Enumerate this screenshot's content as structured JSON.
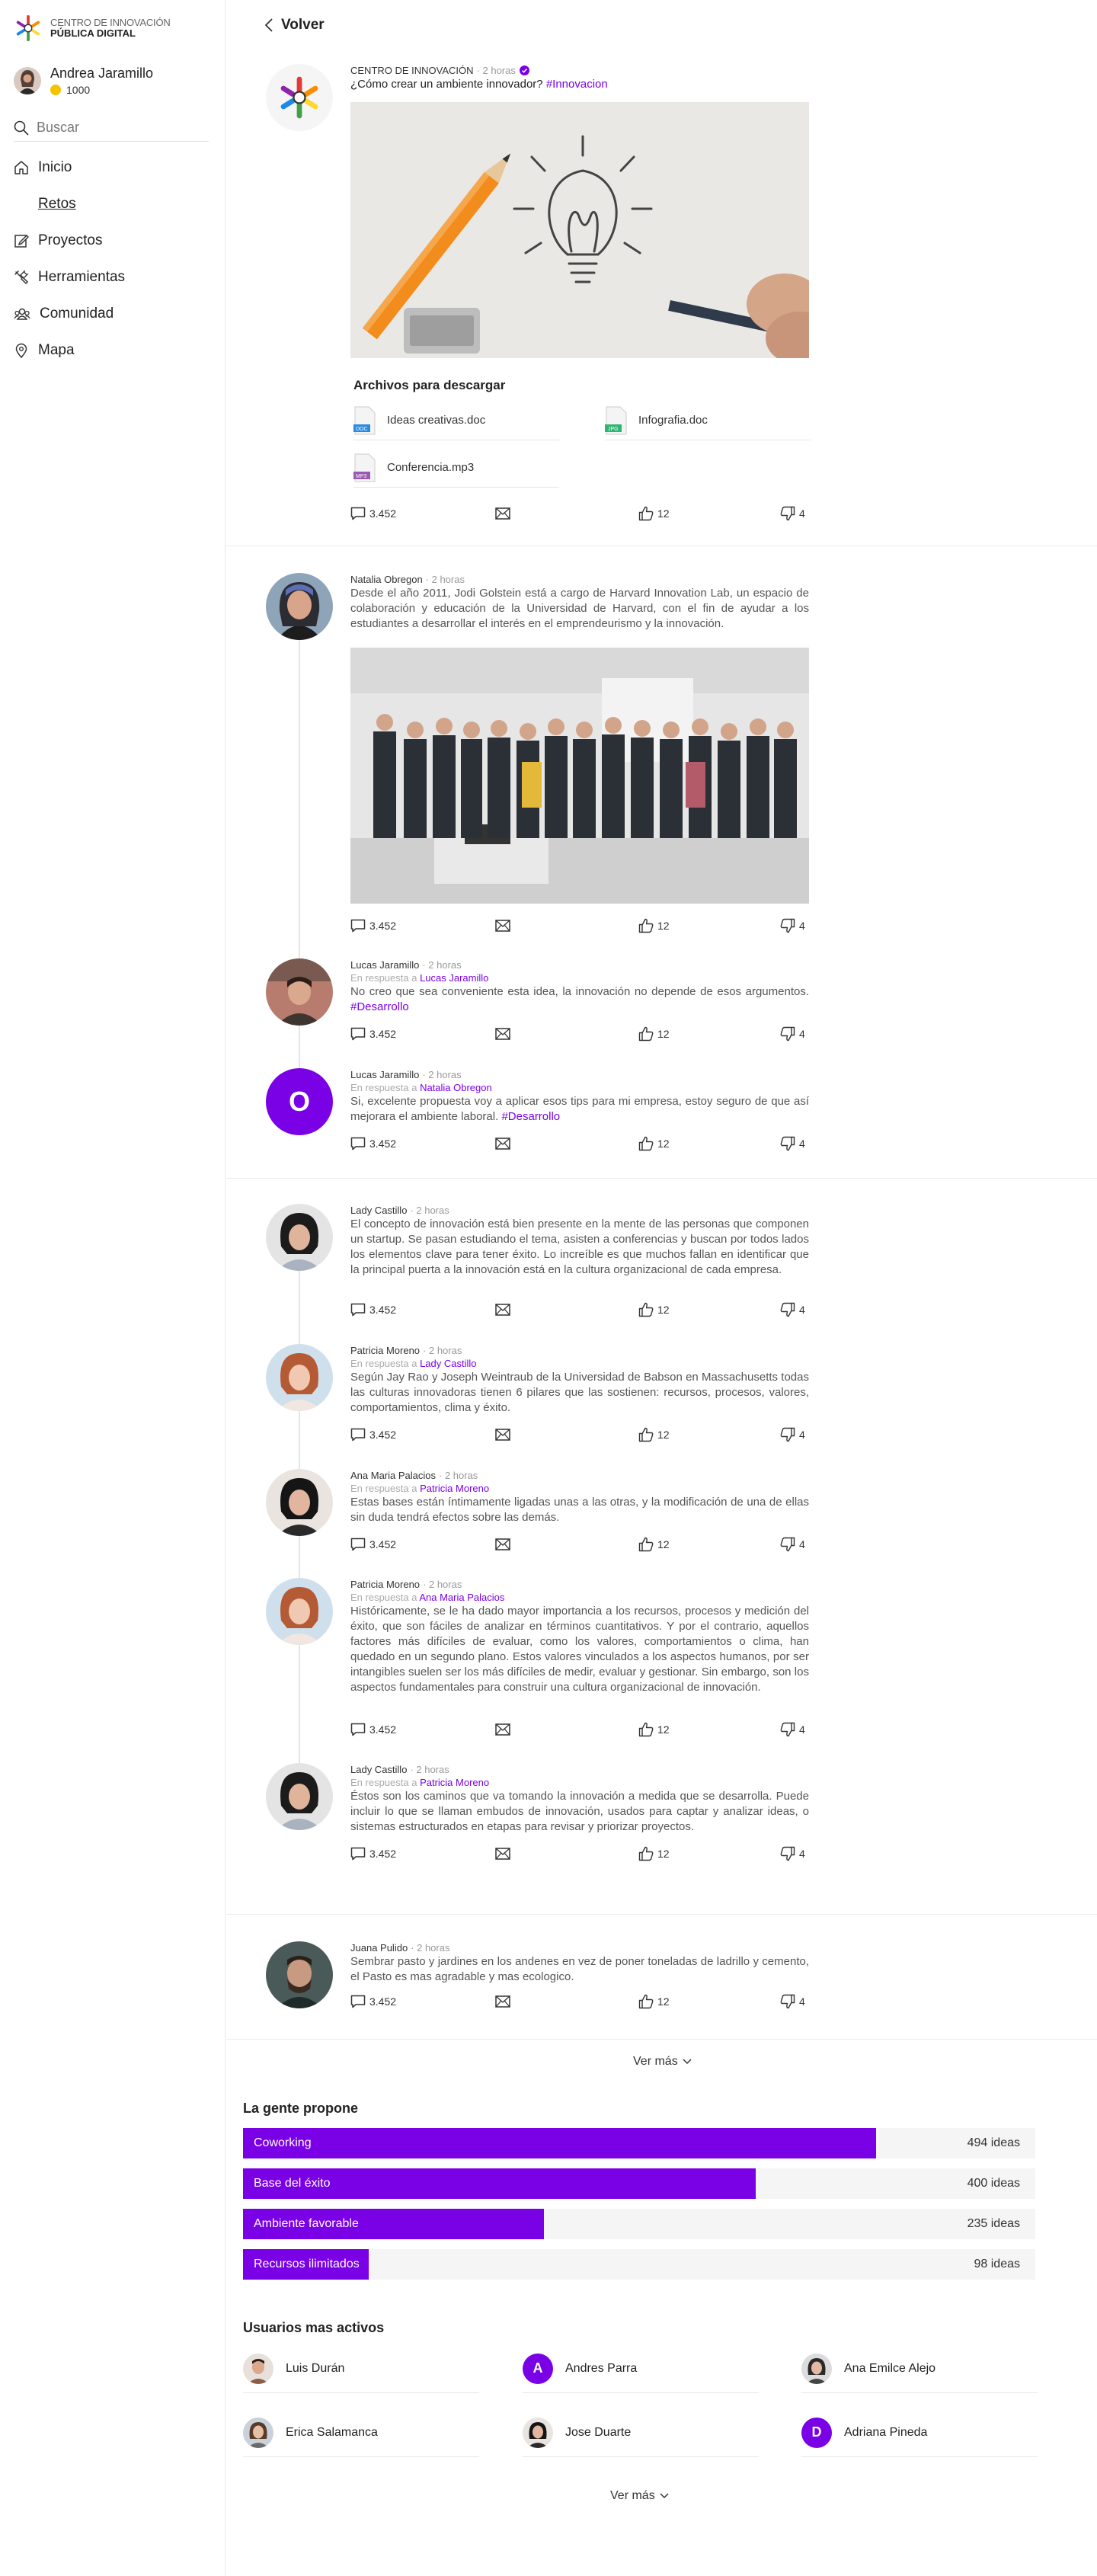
{
  "brand": {
    "line1": "CENTRO DE INNOVACIÓN",
    "line2": "PÚBLICA DIGITAL"
  },
  "user": {
    "name": "Andrea Jaramillo",
    "points": "1000"
  },
  "search": {
    "placeholder": "Buscar"
  },
  "nav": [
    {
      "label": "Inicio",
      "icon": "home-icon"
    },
    {
      "label": "Retos",
      "icon": "flag-icon"
    },
    {
      "label": "Proyectos",
      "icon": "edit-icon"
    },
    {
      "label": "Herramientas",
      "icon": "tools-icon"
    },
    {
      "label": "Comunidad",
      "icon": "community-icon"
    },
    {
      "label": "Mapa",
      "icon": "map-pin-icon"
    }
  ],
  "back_label": "Volver",
  "main_post": {
    "author": "CENTRO DE INNOVACIÓN",
    "time": "· 2 horas",
    "title": "¿Cómo crear un ambiente innovador?",
    "tag": "#Innovacion",
    "files_title": "Archivos para descargar",
    "files": [
      {
        "name": "Ideas creativas.doc",
        "type": "DOC",
        "color": "#2b8ae0"
      },
      {
        "name": "Infografia.doc",
        "type": "JPG",
        "color": "#2bb673"
      },
      {
        "name": "Conferencia.mp3",
        "type": "MP3",
        "color": "#9b59b6"
      }
    ],
    "comments": "3.452",
    "likes": "12",
    "dislikes": "4"
  },
  "threads": [
    {
      "posts": [
        {
          "author": "Natalia Obregon",
          "time": "· 2 horas",
          "reply_prefix": "",
          "reply_to": "",
          "text": "Desde el año 2011, Jodi Golstein está a cargo de Harvard Innovation Lab, un espacio de colaboración y educación de la Universidad de Harvard, con el fin de ayudar a los estudiantes a desarrollar el interés en el emprendeurismo y la innovación.",
          "tag": "",
          "comments": "3.452",
          "likes": "12",
          "dislikes": "4"
        },
        {
          "author": "Lucas Jaramillo",
          "time": "· 2 horas",
          "reply_prefix": "En respuesta a ",
          "reply_to": "Lucas Jaramillo",
          "text": "No creo que sea conveniente esta idea, la innovación no depende de esos argumentos.",
          "tag": "#Desarrollo",
          "comments": "3.452",
          "likes": "12",
          "dislikes": "4"
        },
        {
          "author": "Lucas Jaramillo",
          "time": "· 2 horas",
          "reply_prefix": "En respuesta a ",
          "reply_to": "Natalia Obregon",
          "text": "Si, excelente propuesta voy a aplicar esos tips para mi empresa, estoy seguro de que así mejorara el ambiente laboral.",
          "tag": "#Desarrollo",
          "comments": "3.452",
          "likes": "12",
          "dislikes": "4",
          "avatar_letter": "O"
        }
      ]
    },
    {
      "posts": [
        {
          "author": "Lady Castillo",
          "time": "· 2 horas",
          "reply_prefix": "",
          "reply_to": "",
          "text": "El concepto de innovación está bien presente en la mente de las personas que componen un startup. Se pasan estudiando el tema, asisten a conferencias y buscan por todos lados los elementos clave para tener éxito. Lo increíble es que muchos fallan en identificar que la principal puerta a la innovación está en la cultura organizacional de cada empresa.",
          "tag": "",
          "comments": "3.452",
          "likes": "12",
          "dislikes": "4"
        },
        {
          "author": "Patricia Moreno",
          "time": "· 2 horas",
          "reply_prefix": "En respuesta a ",
          "reply_to": "Lady Castillo",
          "text": "Según Jay Rao y Joseph Weintraub de la Universidad de Babson en Massachusetts todas las culturas innovadoras tienen 6 pilares que las sostienen: recursos, procesos, valores, comportamientos, clima y éxito.",
          "tag": "",
          "comments": "3.452",
          "likes": "12",
          "dislikes": "4"
        },
        {
          "author": "Ana Maria Palacios",
          "time": "· 2 horas",
          "reply_prefix": "En respuesta a ",
          "reply_to": "Patricia Moreno",
          "text": "Estas bases están íntimamente ligadas unas a las otras, y la modificación de una de ellas sin duda tendrá efectos sobre las demás.",
          "tag": "",
          "comments": "3.452",
          "likes": "12",
          "dislikes": "4"
        },
        {
          "author": "Patricia Moreno",
          "time": "· 2 horas",
          "reply_prefix": "En respuesta a ",
          "reply_to": "Ana Maria Palacios",
          "text": "Históricamente, se le ha dado mayor importancia a los recursos, procesos y medición del éxito, que son fáciles de analizar en términos cuantitativos. Y por el contrario, aquellos factores más difíciles de evaluar, como los valores, comportamientos o clima, han quedado en un segundo plano. Estos valores vinculados a los aspectos humanos, por ser intangibles suelen ser los más difíciles de medir, evaluar y gestionar. Sin embargo, son los aspectos fundamentales para construir una cultura organizacional de innovación.",
          "tag": "",
          "comments": "3.452",
          "likes": "12",
          "dislikes": "4"
        },
        {
          "author": "Lady Castillo",
          "time": "· 2 horas",
          "reply_prefix": "En respuesta a ",
          "reply_to": "Patricia Moreno",
          "text": "Éstos son los caminos que va tomando la innovación a medida que se desarrolla. Puede incluir lo que se llaman embudos de innovación, usados para captar y analizar ideas, o sistemas estructurados en etapas para revisar y priorizar proyectos.",
          "tag": "",
          "comments": "3.452",
          "likes": "12",
          "dislikes": "4"
        }
      ]
    },
    {
      "posts": [
        {
          "author": "Juana Pulido",
          "time": "· 2 horas",
          "reply_prefix": "",
          "reply_to": "",
          "text": "Sembrar pasto y jardines en los andenes en vez de poner toneladas de ladrillo y cemento, el Pasto es mas agradable y mas ecologico.",
          "tag": "",
          "comments": "3.452",
          "likes": "12",
          "dislikes": "4"
        }
      ]
    }
  ],
  "ver_mas": "Ver más",
  "proposals": {
    "title": "La gente propone",
    "items": [
      {
        "label": "Coworking",
        "value": 494,
        "value_text": "494 ideas"
      },
      {
        "label": "Base del éxito",
        "value": 400,
        "value_text": "400 ideas"
      },
      {
        "label": "Ambiente favorable",
        "value": 235,
        "value_text": "235 ideas"
      },
      {
        "label": "Recursos ilimitados",
        "value": 98,
        "value_text": "98 ideas"
      }
    ]
  },
  "active_users": {
    "title": "Usuarios mas activos",
    "items": [
      {
        "name": "Luis Durán",
        "letter": ""
      },
      {
        "name": "Andres Parra",
        "letter": "A"
      },
      {
        "name": "Ana Emilce Alejo",
        "letter": ""
      },
      {
        "name": "Erica Salamanca",
        "letter": ""
      },
      {
        "name": "Jose Duarte",
        "letter": ""
      },
      {
        "name": "Adriana Pineda",
        "letter": "D"
      }
    ]
  },
  "colors": {
    "accent": "#7a00e6",
    "coin": "#f5c400"
  }
}
